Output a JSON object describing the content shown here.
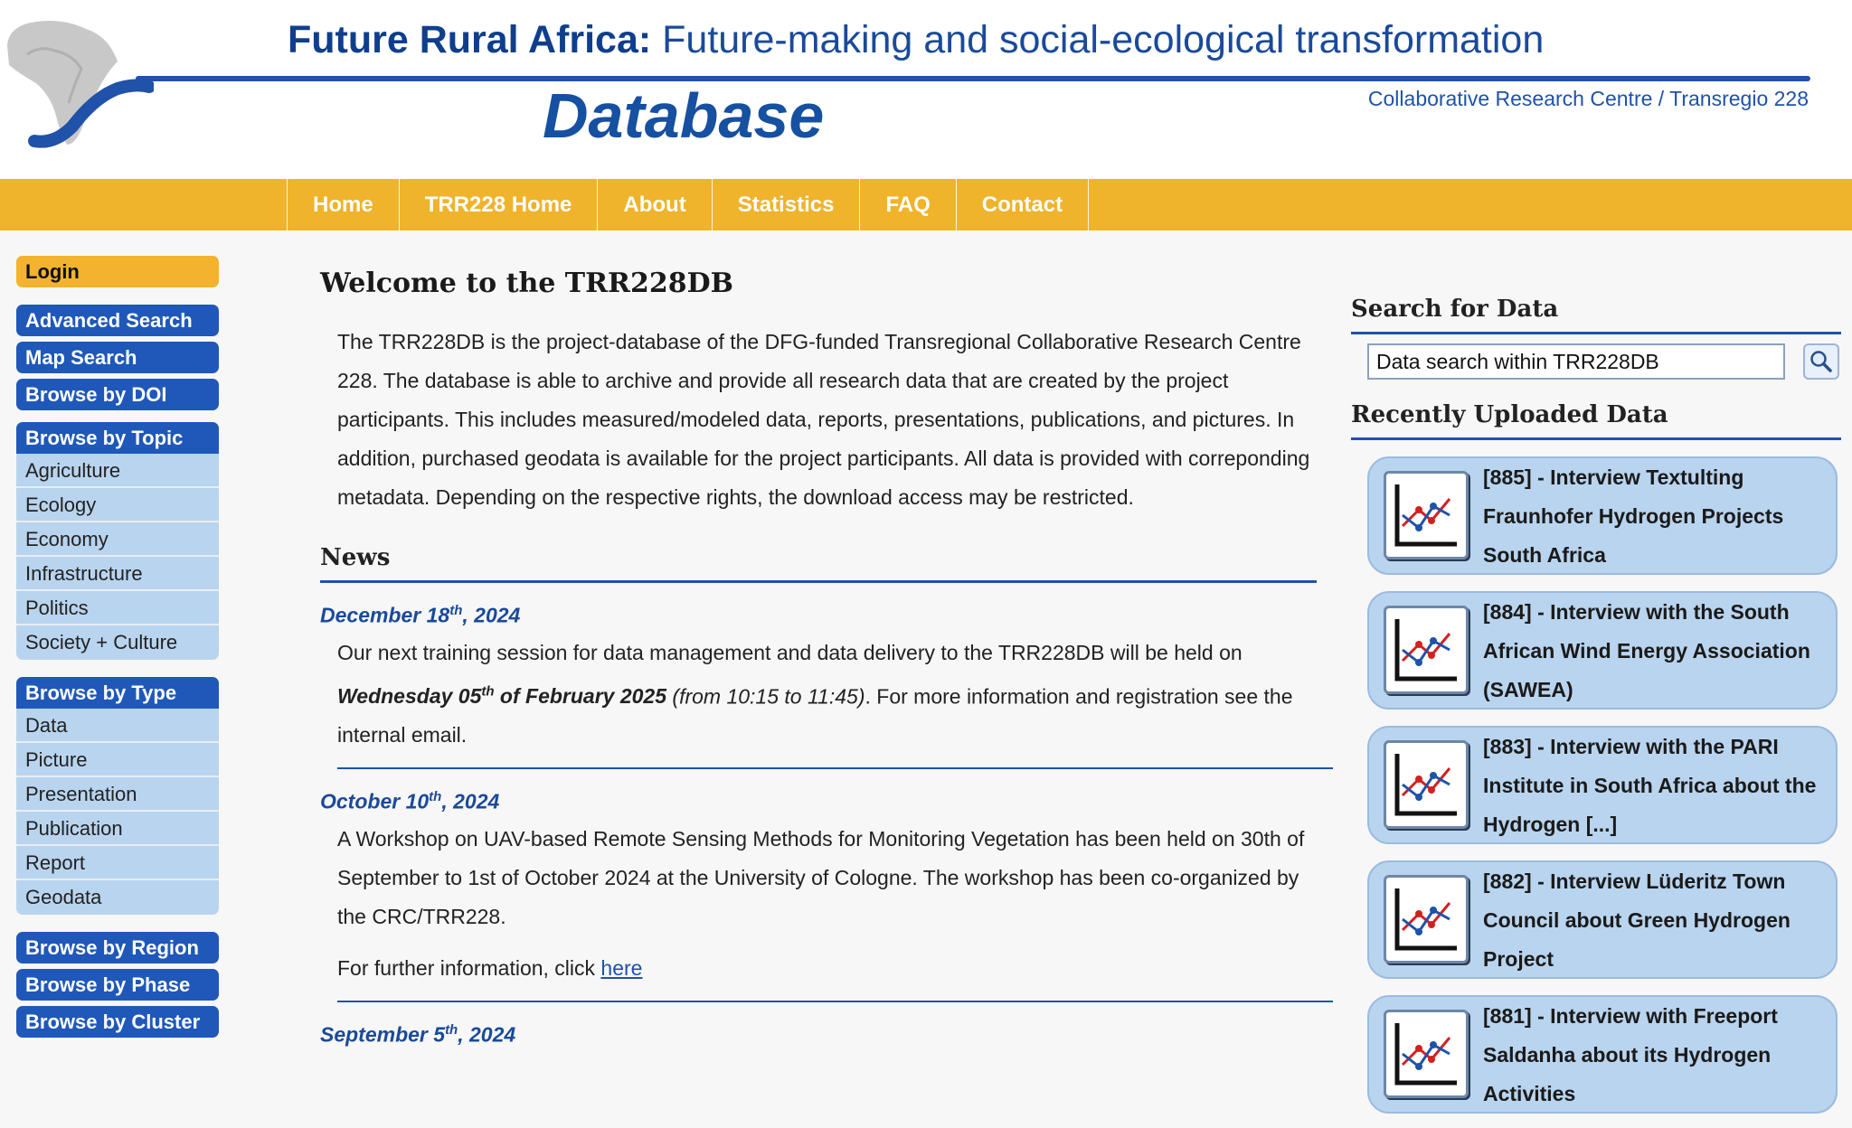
{
  "header": {
    "title_bold": "Future Rural Africa:",
    "title_rest": " Future-making and social-ecological transformation",
    "subtitle": "Database",
    "crc": "Collaborative Research Centre / Transregio 228"
  },
  "nav": [
    "Home",
    "TRR228 Home",
    "About",
    "Statistics",
    "FAQ",
    "Contact"
  ],
  "sidebar": {
    "login": "Login",
    "top_buttons": [
      "Advanced Search",
      "Map Search",
      "Browse by DOI"
    ],
    "topic": {
      "label": "Browse by Topic",
      "items": [
        "Agriculture",
        "Ecology",
        "Economy",
        "Infrastructure",
        "Politics",
        "Society + Culture"
      ]
    },
    "type": {
      "label": "Browse by Type",
      "items": [
        "Data",
        "Picture",
        "Presentation",
        "Publication",
        "Report",
        "Geodata"
      ]
    },
    "bottom_buttons": [
      "Browse by Region",
      "Browse by Phase",
      "Browse by Cluster"
    ]
  },
  "main": {
    "title": "Welcome to the TRR228DB",
    "intro": "The TRR228DB is the project-database of the DFG-funded Transregional Collaborative Research Centre 228. The database is able to archive and provide all research data that are created by the project participants. This includes measured/modeled data, reports, presentations, publications, and pictures. In addition, purchased geodata is available for the project participants. All data is provided with correponding metadata. Depending on the respective rights, the download access may be restricted.",
    "news_heading": "News",
    "news": [
      {
        "date_pre": "December 18",
        "date_sup": "th",
        "date_post": ", 2024",
        "text1": "Our next training session for data management and data delivery to the TRR228DB will be held on ",
        "bold_pre": "Wednesday 05",
        "bold_sup": "th",
        "bold_post": " of February 2025",
        "italic": " (from 10:15 to 11:45)",
        "text2": ". For more information and registration see the internal email."
      },
      {
        "date_pre": "October 10",
        "date_sup": "th",
        "date_post": ", 2024",
        "text": "A Workshop on UAV-based Remote Sensing Methods for Monitoring Vegetation has been held on 30th of September to 1st of October 2024 at the University of Cologne. The workshop has been co-organized by the CRC/TRR228.",
        "further": "For further information, click ",
        "link": "here"
      },
      {
        "date_pre": "September 5",
        "date_sup": "th",
        "date_post": ", 2024"
      }
    ]
  },
  "right": {
    "search_heading": "Search for Data",
    "search_value": "Data search within TRR228DB",
    "recent_heading": "Recently Uploaded Data",
    "recent": [
      "[885] - Interview Textulting Fraunhofer Hydrogen Projects South Africa",
      "[884] - Interview with the South African Wind Energy Association (SAWEA)",
      "[883] - Interview with the PARI Institute in South Africa about the Hydrogen [...]",
      "[882] - Interview Lüderitz Town Council about Green Hydrogen Project",
      "[881] - Interview with Freeport Saldanha about its Hydrogen Activities"
    ]
  },
  "colors": {
    "nav_bg": "#efb32c",
    "brand_blue": "#1f52a8",
    "sub_item_bg": "#b9d4ee"
  }
}
